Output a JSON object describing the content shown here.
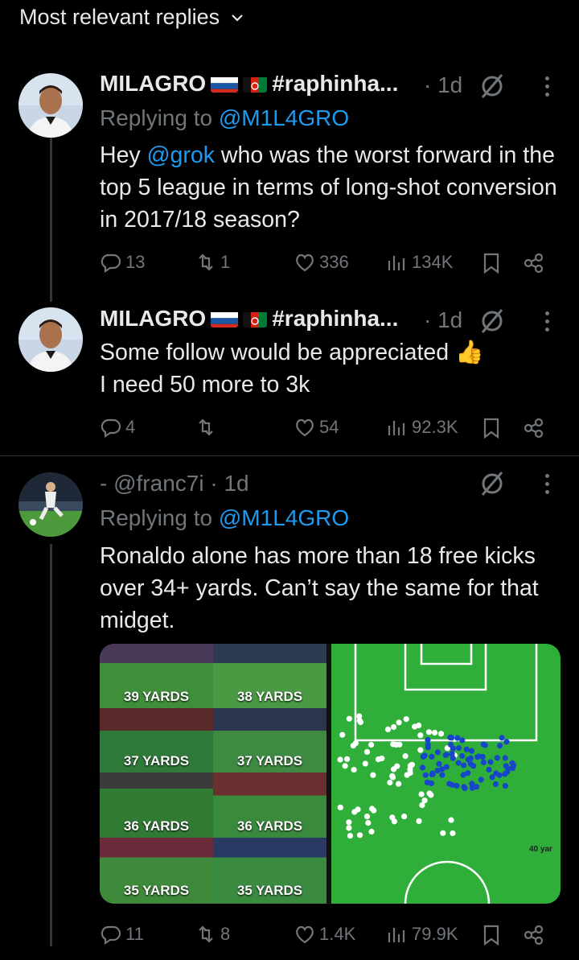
{
  "header": {
    "title": "Most relevant replies"
  },
  "replies": [
    {
      "author_name": "MILAGRO",
      "author_suffix": "#raphinha...",
      "time": "· 1d",
      "replying_prefix": "Replying to ",
      "replying_handle": "@M1L4GRO",
      "text_prefix": "Hey ",
      "mention": "@grok",
      "text_rest": "  who was the worst forward in the top 5 league in terms of long-shot conversion in 2017/18 season?",
      "stats": {
        "replies": "13",
        "reposts": "1",
        "likes": "336",
        "views": "134K"
      }
    },
    {
      "author_name": "MILAGRO",
      "author_suffix": "#raphinha...",
      "time": "· 1d",
      "line1": "Some follow would be appreciated",
      "line1_emoji": "👍",
      "line2": "I need 50 more to 3k",
      "stats": {
        "replies": "4",
        "reposts": "",
        "likes": "54",
        "views": "92.3K"
      }
    },
    {
      "author_name": "- @franc7i",
      "time": "· 1d",
      "replying_prefix": "Replying to ",
      "replying_handle": "@M1L4GRO",
      "text": "Ronaldo alone has more than 18 free kicks over 34+ yards. Can’t say the same for that midget.",
      "media_clips": [
        "39 YARDS",
        "38 YARDS",
        "37 YARDS",
        "37 YARDS",
        "36 YARDS",
        "36 YARDS",
        "35 YARDS",
        "35 YARDS"
      ],
      "pitch_label": "40 yar",
      "stats": {
        "replies": "11",
        "reposts": "8",
        "likes": "1.4K",
        "views": "79.9K"
      }
    }
  ],
  "colors": {
    "background": "#000000",
    "text": "#e7e9ea",
    "muted": "#71767b",
    "link": "#1d9bf0",
    "divider": "#2f3336",
    "pitch": "#2fae3a"
  }
}
